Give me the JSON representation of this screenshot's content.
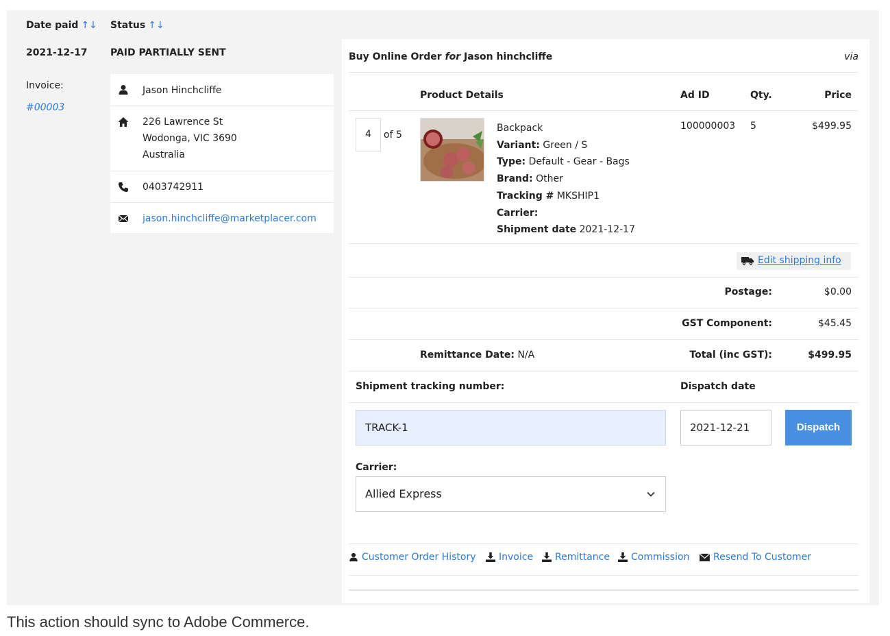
{
  "table_header": {
    "date_paid": "Date paid",
    "status": "Status",
    "sort_arrows": "↑↓"
  },
  "row": {
    "date_paid": "2021-12-17",
    "status": "PAID PARTIALLY SENT",
    "invoice_label": "Invoice:",
    "invoice_number": "#00003"
  },
  "customer": {
    "name": "Jason Hinchcliffe",
    "address_line1": "226 Lawrence St",
    "address_line2": "Wodonga, VIC 3690",
    "address_line3": "Australia",
    "phone": "0403742911",
    "email": "jason.hinchcliffe@marketplacer.com",
    "icons": [
      "user-icon",
      "home-icon",
      "phone-icon",
      "envelope-icon"
    ]
  },
  "order": {
    "title_prefix": "Buy Online Order",
    "title_for": "for",
    "title_name": "Jason hinchcliffe",
    "via": "via",
    "columns": {
      "product_details": "Product Details",
      "ad_id": "Ad ID",
      "qty": "Qty.",
      "price": "Price"
    },
    "item": {
      "qty_value": "4",
      "of_total": "of 5",
      "name": "Backpack",
      "variant_label": "Variant:",
      "variant": "Green / S",
      "type_label": "Type:",
      "type": "Default - Gear - Bags",
      "brand_label": "Brand:",
      "brand": "Other",
      "tracking_label": "Tracking #",
      "tracking": "MKSHIP1",
      "carrier_label": "Carrier:",
      "shipment_date_label": "Shipment date",
      "shipment_date": "2021-12-17",
      "ad_id": "100000003",
      "qty": "5",
      "price": "$499.95"
    },
    "edit_shipping": "Edit shipping info",
    "postage_label": "Postage:",
    "postage": "$0.00",
    "gst_label": "GST Component:",
    "gst": "$45.45",
    "remittance_label": "Remittance Date:",
    "remittance": "N/A",
    "total_label": "Total (inc GST):",
    "total": "$499.95"
  },
  "dispatch_form": {
    "tracking_label": "Shipment tracking number:",
    "tracking_value": "TRACK-1",
    "dispatch_date_label": "Dispatch date",
    "dispatch_date_value": "2021-12-21",
    "dispatch_button": "Dispatch",
    "carrier_label": "Carrier:",
    "carrier_value": "Allied Express"
  },
  "actions": {
    "customer_history": "Customer Order History",
    "invoice": "Invoice",
    "remittance": "Remittance",
    "commission": "Commission",
    "resend": "Resend To Customer"
  },
  "colors": {
    "link": "#2a7ad8",
    "dispatch_button": "#4a90e2",
    "panel_bg": "#f3f3f3",
    "tracking_input_bg": "#e8f0fe"
  },
  "footer_note": "This action should sync to Adobe Commerce."
}
